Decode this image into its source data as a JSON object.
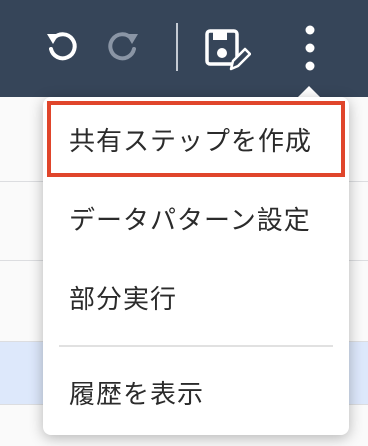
{
  "toolbar": {
    "undo_icon": "undo-icon",
    "redo_icon": "redo-icon",
    "save_edit_icon": "save-edit-icon",
    "more_icon": "more-vertical-icon",
    "bg_color": "#364559"
  },
  "menu": {
    "items": [
      {
        "label": "共有ステップを作成",
        "highlighted": true
      },
      {
        "label": "データパターン設定"
      },
      {
        "label": "部分実行"
      },
      {
        "label": "履歴を表示"
      }
    ],
    "highlight_color": "#e0452b"
  }
}
